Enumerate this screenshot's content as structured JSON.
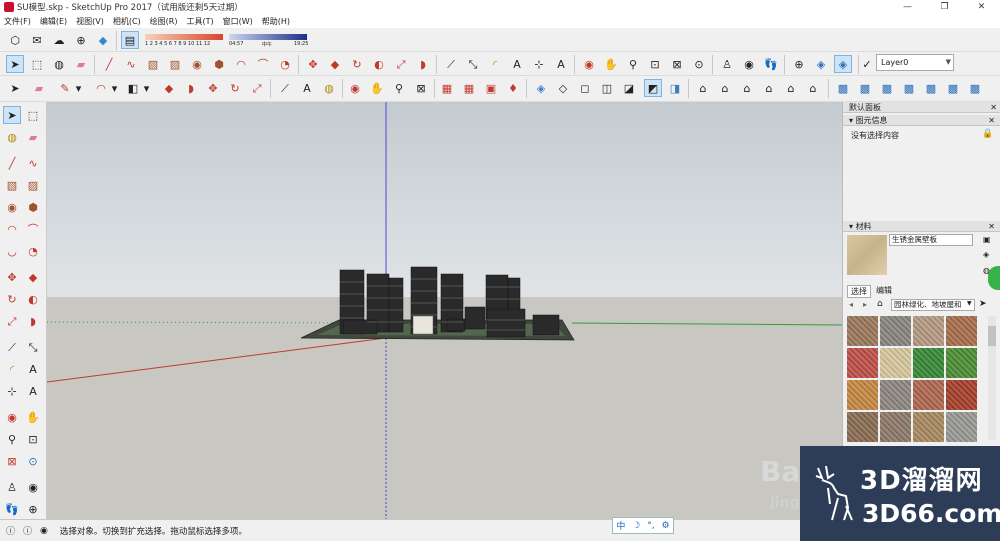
{
  "window": {
    "title": "SU模型.skp - SketchUp Pro 2017（试用版还剩5天过期）",
    "controls": {
      "minimize": "—",
      "maximize": "❐",
      "close": "✕"
    }
  },
  "menu": [
    "文件(F)",
    "编辑(E)",
    "视图(V)",
    "相机(C)",
    "绘图(R)",
    "工具(T)",
    "窗口(W)",
    "帮助(H)"
  ],
  "shadow_bar": {
    "months": "1 2 3 4 5 6 7 8 9 10 11 12",
    "time_start": "04:57",
    "time_mid": "中午",
    "time_end": "19:25"
  },
  "layer": {
    "selected": "Layer0"
  },
  "right_panel": {
    "tray_title": "默认面板",
    "entity_info": {
      "title": "图元信息",
      "status": "没有选择内容"
    },
    "materials": {
      "title": "材料",
      "current_name": "生锈金属壁板",
      "tabs": [
        "选择",
        "编辑"
      ],
      "collection": "园林绿化、地坡屋和"
    },
    "swatches": [
      "#9b7a5d",
      "#8a8780",
      "#b59b84",
      "#a9704f",
      "#c0514b",
      "#d8c89e",
      "#3b8a3a",
      "#4f8f36",
      "#c58a45",
      "#8e8a82",
      "#b06a52",
      "#a7422f",
      "#8b6e55",
      "#8f7b6b",
      "#a88b63",
      "#9a9a96"
    ]
  },
  "status": {
    "text": "选择对象。切换到扩充选择。拖动鼠标选择多项。"
  },
  "ime": {
    "lang": "中",
    "moon": "☽",
    "punct": "°,",
    "gear": "⚙"
  },
  "watermark": {
    "site": "3D溜溜网",
    "domain": "3D66.com",
    "baidu": "Bai",
    "baidu_sub": "jing"
  },
  "colors": {
    "x_axis_red": "#c0392b",
    "y_axis_green": "#2e9e3a",
    "z_axis_blue": "#4a4ad6",
    "accent": "#2e3d57"
  }
}
